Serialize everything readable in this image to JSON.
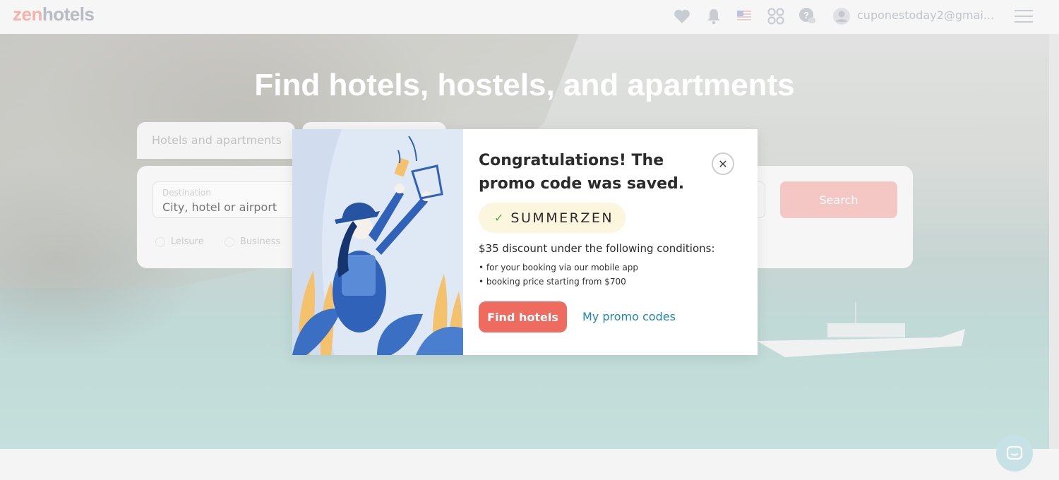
{
  "header": {
    "logo_zen": "zen",
    "logo_hotels": "hotels",
    "icons": [
      "heart-icon",
      "bell-icon",
      "us-flag-icon",
      "currency-icon",
      "help-icon",
      "avatar-icon",
      "menu-icon"
    ],
    "user_email": "cuponestoday2@gmai..."
  },
  "hero": {
    "title": "Find hotels, hostels, and apartments"
  },
  "search": {
    "tab_hotels": "Hotels and apartments",
    "destination_label": "Destination",
    "destination_placeholder": "City, hotel or airport",
    "trip_leisure": "Leisure",
    "trip_business": "Business",
    "search_button": "Search"
  },
  "modal": {
    "title": "Congratulations! The promo code was saved.",
    "promo_code": "SUMMERZEN",
    "conditions_heading": "$35 discount under the following conditions:",
    "conditions": [
      "for your booking via our mobile app",
      "booking price starting from $700"
    ],
    "find_hotels_button": "Find hotels",
    "my_promo_codes_link": "My promo codes"
  },
  "colors": {
    "brand_coral": "#ef6a5f",
    "link_blue": "#1d87b5",
    "promo_bg": "#fcf6df",
    "check_green": "#49a84a"
  }
}
